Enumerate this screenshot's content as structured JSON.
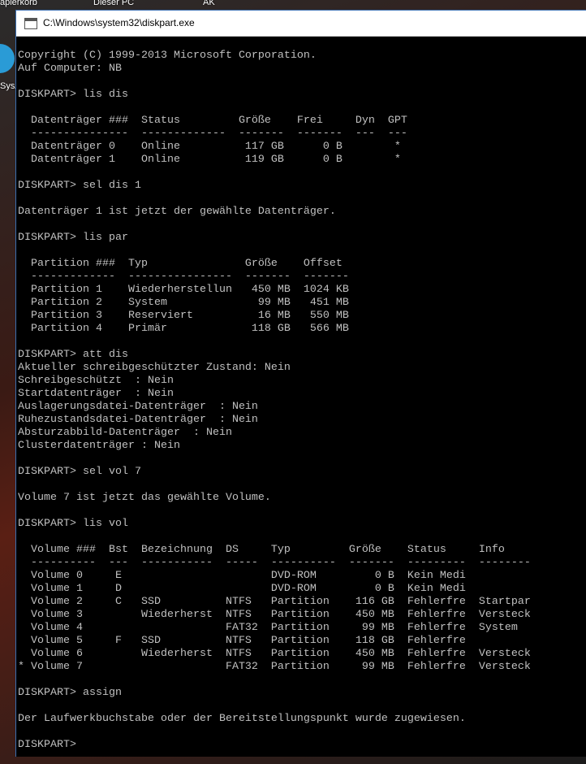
{
  "desktop": {
    "icon_labels": [
      "apierkorb",
      "Dieser PC",
      "AK"
    ],
    "side_icon_label": "SysA"
  },
  "window": {
    "title": "C:\\Windows\\system32\\diskpart.exe"
  },
  "console_lines": [
    "Copyright (C) 1999-2013 Microsoft Corporation.",
    "Auf Computer: NB",
    "",
    "DISKPART> lis dis",
    "",
    "  Datenträger ###  Status         Größe    Frei     Dyn  GPT",
    "  ---------------  -------------  -------  -------  ---  ---",
    "  Datenträger 0    Online          117 GB      0 B        *",
    "  Datenträger 1    Online          119 GB      0 B        *",
    "",
    "DISKPART> sel dis 1",
    "",
    "Datenträger 1 ist jetzt der gewählte Datenträger.",
    "",
    "DISKPART> lis par",
    "",
    "  Partition ###  Typ               Größe    Offset",
    "  -------------  ----------------  -------  -------",
    "  Partition 1    Wiederherstellun   450 MB  1024 KB",
    "  Partition 2    System              99 MB   451 MB",
    "  Partition 3    Reserviert          16 MB   550 MB",
    "  Partition 4    Primär             118 GB   566 MB",
    "",
    "DISKPART> att dis",
    "Aktueller schreibgeschützter Zustand: Nein",
    "Schreibgeschützt  : Nein",
    "Startdatenträger  : Nein",
    "Auslagerungsdatei-Datenträger  : Nein",
    "Ruhezustandsdatei-Datenträger  : Nein",
    "Absturzabbild-Datenträger  : Nein",
    "Clusterdatenträger : Nein",
    "",
    "DISKPART> sel vol 7",
    "",
    "Volume 7 ist jetzt das gewählte Volume.",
    "",
    "DISKPART> lis vol",
    "",
    "  Volume ###  Bst  Bezeichnung  DS     Typ         Größe    Status     Info",
    "  ----------  ---  -----------  -----  ----------  -------  ---------  --------",
    "  Volume 0     E                       DVD-ROM         0 B  Kein Medi",
    "  Volume 1     D                       DVD-ROM         0 B  Kein Medi",
    "  Volume 2     C   SSD          NTFS   Partition    116 GB  Fehlerfre  Startpar",
    "  Volume 3         Wiederherst  NTFS   Partition    450 MB  Fehlerfre  Versteck",
    "  Volume 4                      FAT32  Partition     99 MB  Fehlerfre  System",
    "  Volume 5     F   SSD          NTFS   Partition    118 GB  Fehlerfre",
    "  Volume 6         Wiederherst  NTFS   Partition    450 MB  Fehlerfre  Versteck",
    "* Volume 7                      FAT32  Partition     99 MB  Fehlerfre  Versteck",
    "",
    "DISKPART> assign",
    "",
    "Der Laufwerkbuchstabe oder der Bereitstellungspunkt wurde zugewiesen.",
    "",
    "DISKPART> "
  ]
}
